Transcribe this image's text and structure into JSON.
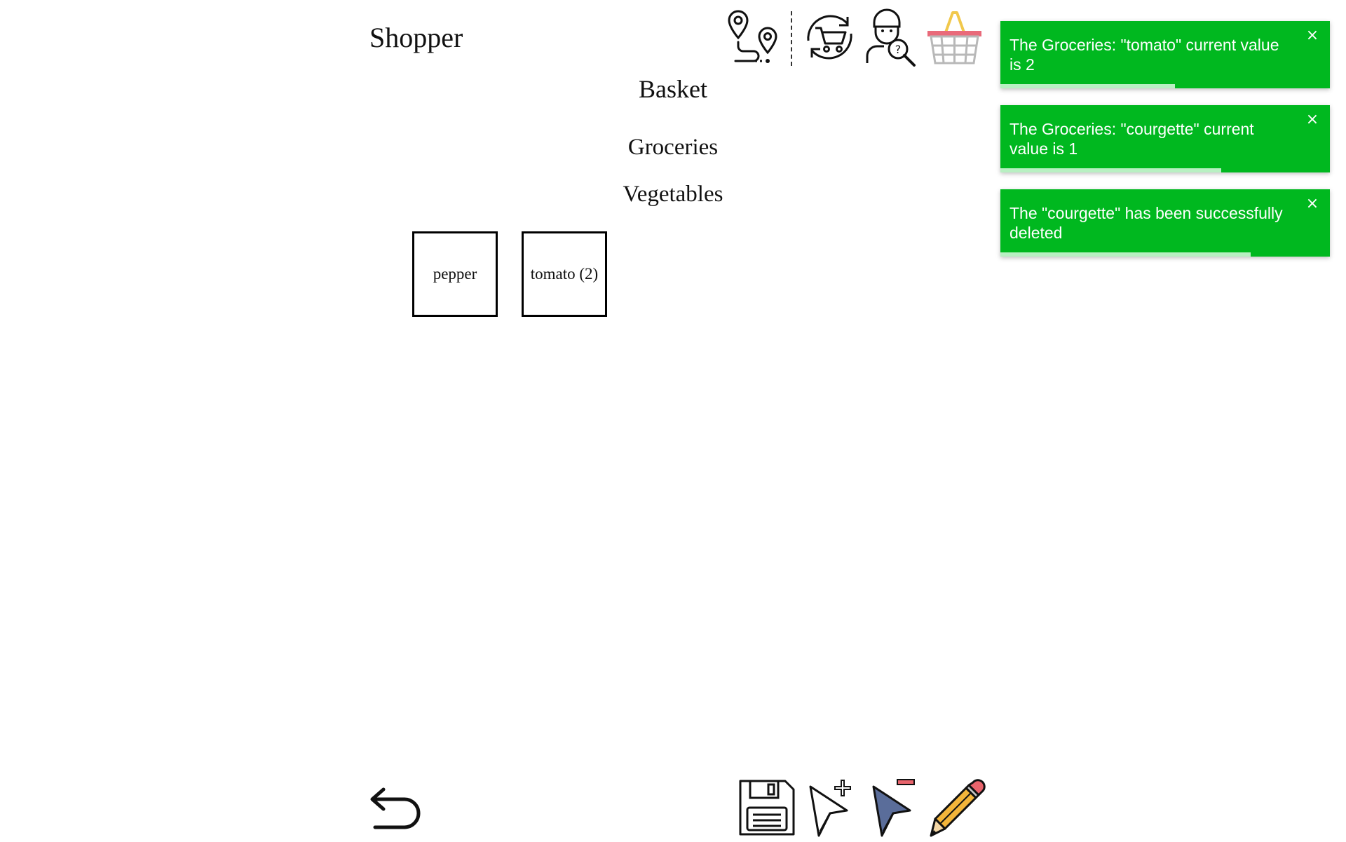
{
  "app": {
    "title": "Shopper"
  },
  "header_icons": [
    {
      "name": "route-map-icon"
    },
    {
      "name": "cart-sync-icon"
    },
    {
      "name": "user-search-icon"
    },
    {
      "name": "basket-icon"
    }
  ],
  "page": {
    "title": "Basket",
    "category": "Groceries",
    "subcategory": "Vegetables"
  },
  "items": [
    {
      "label": "pepper"
    },
    {
      "label": "tomato (2)"
    }
  ],
  "notifications": [
    {
      "message": "The Groceries: \"tomato\" current value is 2",
      "close": "×",
      "progress": 0.53
    },
    {
      "message": "The Groceries: \"courgette\" current value is 1",
      "close": "×",
      "progress": 0.67
    },
    {
      "message": "The \"courgette\" has been successfully deleted",
      "close": "×",
      "progress": 0.76
    }
  ],
  "toolbar": {
    "back": "back-arrow-icon",
    "save": "save-icon",
    "add_select": "cursor-add-icon",
    "remove_select": "cursor-remove-icon",
    "edit": "pencil-icon"
  },
  "colors": {
    "toast_bg": "#00b81f",
    "toast_progress": "#b8f0c2"
  }
}
